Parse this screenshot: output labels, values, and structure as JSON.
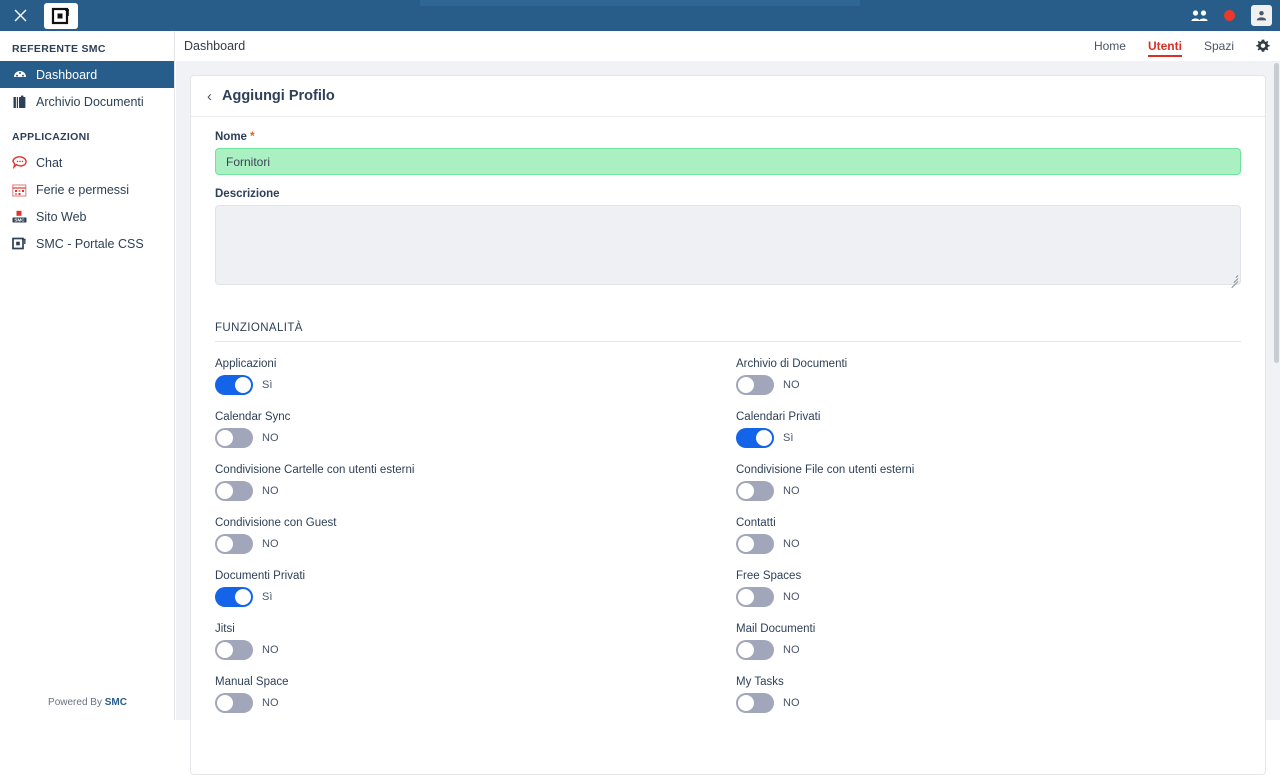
{
  "header": {
    "close_icon": "close-icon",
    "logo_icon": "smc-logo-icon",
    "people_icon": "people-icon",
    "record_icon": "record-dot-icon",
    "avatar_icon": "user-avatar-icon",
    "bg_color": "#285d8a"
  },
  "sidebar": {
    "section_label": "REFERENTE SMC",
    "items": [
      {
        "label": "Dashboard",
        "icon": "dashboard-icon",
        "active": true
      },
      {
        "label": "Archivio Documenti",
        "icon": "archive-icon",
        "active": false
      }
    ],
    "apps_label": "APPLICAZIONI",
    "apps": [
      {
        "label": "Chat",
        "icon": "chat-icon"
      },
      {
        "label": "Ferie e permessi",
        "icon": "calendar-leave-icon"
      },
      {
        "label": "Sito Web",
        "icon": "website-icon"
      },
      {
        "label": "SMC - Portale CSS",
        "icon": "smc-portal-icon"
      }
    ],
    "powered_prefix": "Powered By ",
    "powered_brand": "SMC"
  },
  "breadcrumb": {
    "text": "Dashboard"
  },
  "topnav": {
    "items": [
      {
        "label": "Home",
        "active": false
      },
      {
        "label": "Utenti",
        "active": true
      },
      {
        "label": "Spazi",
        "active": false
      }
    ],
    "settings_icon": "gear-icon",
    "active_color": "#d93025"
  },
  "card": {
    "back_icon": "chevron-left-icon",
    "title": "Aggiungi Profilo"
  },
  "form": {
    "nome_label": "Nome",
    "nome_required": "*",
    "nome_value": "Fornitori",
    "nome_placeholder": "",
    "nome_bg_color": "#abf0c3",
    "descrizione_label": "Descrizione",
    "descrizione_value": "",
    "descrizione_placeholder": ""
  },
  "functionality": {
    "section_title": "FUNZIONALITÀ",
    "yes_label": "Sì",
    "no_label": "NO",
    "on_color": "#1364e8",
    "off_color": "#a2a6ba",
    "toggles": [
      {
        "label": "Applicazioni",
        "state": "on",
        "value": "Sì"
      },
      {
        "label": "Archivio di Documenti",
        "state": "off",
        "value": "NO"
      },
      {
        "label": "Calendar Sync",
        "state": "off",
        "value": "NO"
      },
      {
        "label": "Calendari Privati",
        "state": "on",
        "value": "Sì"
      },
      {
        "label": "Condivisione Cartelle con utenti esterni",
        "state": "off",
        "value": "NO"
      },
      {
        "label": "Condivisione File con utenti esterni",
        "state": "off",
        "value": "NO"
      },
      {
        "label": "Condivisione con Guest",
        "state": "off",
        "value": "NO"
      },
      {
        "label": "Contatti",
        "state": "off",
        "value": "NO"
      },
      {
        "label": "Documenti Privati",
        "state": "on",
        "value": "Sì"
      },
      {
        "label": "Free Spaces",
        "state": "off",
        "value": "NO"
      },
      {
        "label": "Jitsi",
        "state": "off",
        "value": "NO"
      },
      {
        "label": "Mail Documenti",
        "state": "off",
        "value": "NO"
      },
      {
        "label": "Manual Space",
        "state": "off",
        "value": "NO"
      },
      {
        "label": "My Tasks",
        "state": "off",
        "value": "NO"
      }
    ]
  }
}
